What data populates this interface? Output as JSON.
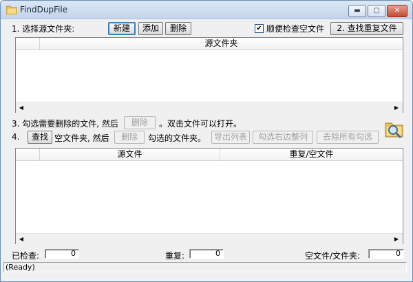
{
  "window": {
    "title": "FindDupFile",
    "controls": {
      "minimize": "▬",
      "maximize": "▢",
      "close": "✕"
    }
  },
  "step1": {
    "label": "1. 选择源文件夹:",
    "buttons": {
      "new": "新建",
      "add": "添加",
      "delete": "删除"
    },
    "check_empty": {
      "label": "顺便检查空文件",
      "checked": true
    },
    "find_button": "2. 查找重复文件"
  },
  "source_list": {
    "columns": [
      "源文件夹"
    ]
  },
  "step3": {
    "label": "3. 勾选需要删除的文件, 然后",
    "delete_button": "删除",
    "hint": "。双击文件可以打开。"
  },
  "step4": {
    "prefix": "4.",
    "find_button": "查找",
    "text_mid": "空文件夹, 然后",
    "delete_button": "删除",
    "text_after": "勾选的文件夹。",
    "export_button": "导出列表",
    "check_right_button": "勾选右边整列",
    "uncheck_all_button": "去除所有勾选"
  },
  "results_list": {
    "columns": [
      "源文件",
      "重复/空文件"
    ]
  },
  "stats": {
    "checked_label": "已检查:",
    "checked_value": "0",
    "dup_label": "重复:",
    "dup_value": "0",
    "empty_label": "空文件/文件夹:",
    "empty_value": "0"
  },
  "status": {
    "text": "(Ready)"
  },
  "icons": {
    "app": "folder-icon",
    "search_folder": "folder-search-icon",
    "scroll_left": "◀",
    "scroll_right": "▶"
  }
}
